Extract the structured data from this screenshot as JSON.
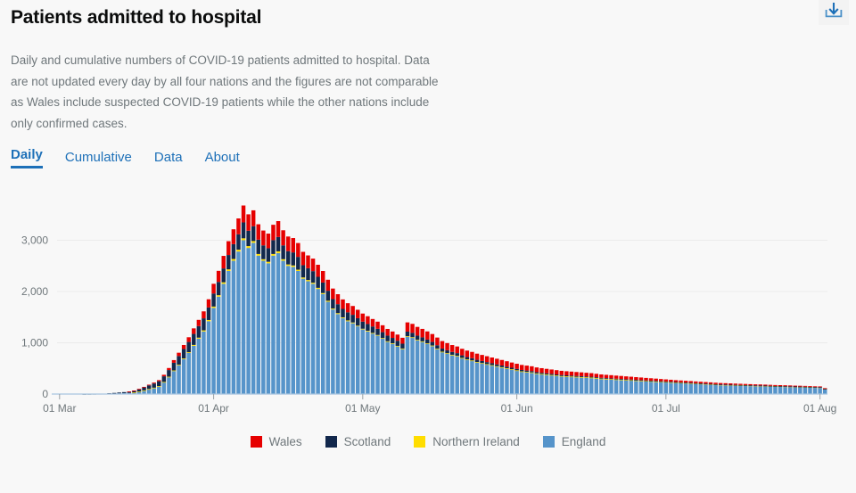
{
  "header": {
    "title": "Patients admitted to hospital",
    "description": "Daily and cumulative numbers of COVID-19 patients admitted to hospital. Data are not updated every day by all four nations and the figures are not comparable as Wales include suspected COVID-19 patients while the other nations include only confirmed cases.",
    "download_icon": "download-icon"
  },
  "tabs": [
    {
      "label": "Daily",
      "active": true
    },
    {
      "label": "Cumulative",
      "active": false
    },
    {
      "label": "Data",
      "active": false
    },
    {
      "label": "About",
      "active": false
    }
  ],
  "colors": {
    "wales": "#e60000",
    "scotland": "#12284c",
    "northern_ireland": "#ffdd00",
    "england": "#5694ca",
    "accent": "#1d70b8",
    "text_muted": "#6f777b",
    "background": "#f8f8f8",
    "gridline": "#ebebeb"
  },
  "chart_data": {
    "type": "bar",
    "stacked": true,
    "title": "Patients admitted to hospital",
    "xlabel": "",
    "ylabel": "",
    "ylim": [
      0,
      3600
    ],
    "grid": true,
    "legend_position": "bottom",
    "y_ticks": [
      "0",
      "1,000",
      "2,000",
      "3,000"
    ],
    "y_tick_values": [
      0,
      1000,
      2000,
      3000
    ],
    "x_ticks": [
      "01 Mar",
      "01 Apr",
      "01 May",
      "01 Jun",
      "01 Jul",
      "01 Aug"
    ],
    "x_tick_indices": [
      0,
      31,
      61,
      92,
      122,
      153
    ],
    "categories": [
      "01 Mar",
      "02 Mar",
      "03 Mar",
      "04 Mar",
      "05 Mar",
      "06 Mar",
      "07 Mar",
      "08 Mar",
      "09 Mar",
      "10 Mar",
      "11 Mar",
      "12 Mar",
      "13 Mar",
      "14 Mar",
      "15 Mar",
      "16 Mar",
      "17 Mar",
      "18 Mar",
      "19 Mar",
      "20 Mar",
      "21 Mar",
      "22 Mar",
      "23 Mar",
      "24 Mar",
      "25 Mar",
      "26 Mar",
      "27 Mar",
      "28 Mar",
      "29 Mar",
      "30 Mar",
      "31 Mar",
      "01 Apr",
      "02 Apr",
      "03 Apr",
      "04 Apr",
      "05 Apr",
      "06 Apr",
      "07 Apr",
      "08 Apr",
      "09 Apr",
      "10 Apr",
      "11 Apr",
      "12 Apr",
      "13 Apr",
      "14 Apr",
      "15 Apr",
      "16 Apr",
      "17 Apr",
      "18 Apr",
      "19 Apr",
      "20 Apr",
      "21 Apr",
      "22 Apr",
      "23 Apr",
      "24 Apr",
      "25 Apr",
      "26 Apr",
      "27 Apr",
      "28 Apr",
      "29 Apr",
      "30 Apr",
      "01 May",
      "02 May",
      "03 May",
      "04 May",
      "05 May",
      "06 May",
      "07 May",
      "08 May",
      "09 May",
      "10 May",
      "11 May",
      "12 May",
      "13 May",
      "14 May",
      "15 May",
      "16 May",
      "17 May",
      "18 May",
      "19 May",
      "20 May",
      "21 May",
      "22 May",
      "23 May",
      "24 May",
      "25 May",
      "26 May",
      "27 May",
      "28 May",
      "29 May",
      "30 May",
      "31 May",
      "01 Jun",
      "02 Jun",
      "03 Jun",
      "04 Jun",
      "05 Jun",
      "06 Jun",
      "07 Jun",
      "08 Jun",
      "09 Jun",
      "10 Jun",
      "11 Jun",
      "12 Jun",
      "13 Jun",
      "14 Jun",
      "15 Jun",
      "16 Jun",
      "17 Jun",
      "18 Jun",
      "19 Jun",
      "20 Jun",
      "21 Jun",
      "22 Jun",
      "23 Jun",
      "24 Jun",
      "25 Jun",
      "26 Jun",
      "27 Jun",
      "28 Jun",
      "29 Jun",
      "30 Jun",
      "01 Jul",
      "02 Jul",
      "03 Jul",
      "04 Jul",
      "05 Jul",
      "06 Jul",
      "07 Jul",
      "08 Jul",
      "09 Jul",
      "10 Jul",
      "11 Jul",
      "12 Jul",
      "13 Jul",
      "14 Jul",
      "15 Jul",
      "16 Jul",
      "17 Jul",
      "18 Jul",
      "19 Jul",
      "20 Jul",
      "21 Jul",
      "22 Jul",
      "23 Jul",
      "24 Jul",
      "25 Jul",
      "26 Jul",
      "27 Jul",
      "28 Jul",
      "29 Jul",
      "30 Jul",
      "31 Jul",
      "01 Aug",
      "02 Aug"
    ],
    "series": [
      {
        "name": "England",
        "color": "#5694ca",
        "values": [
          0,
          0,
          0,
          0,
          0,
          0,
          0,
          0,
          0,
          0,
          8,
          10,
          14,
          18,
          22,
          30,
          48,
          70,
          96,
          120,
          150,
          230,
          330,
          450,
          560,
          680,
          800,
          940,
          1080,
          1220,
          1420,
          1680,
          1900,
          2150,
          2400,
          2600,
          2780,
          3000,
          2850,
          2950,
          2700,
          2600,
          2550,
          2700,
          2750,
          2600,
          2500,
          2480,
          2400,
          2250,
          2200,
          2150,
          2050,
          1950,
          1800,
          1650,
          1560,
          1480,
          1420,
          1380,
          1320,
          1260,
          1220,
          1180,
          1140,
          1080,
          1020,
          980,
          930,
          880,
          1120,
          1100,
          1050,
          1020,
          980,
          940,
          880,
          820,
          790,
          760,
          740,
          700,
          670,
          650,
          620,
          600,
          580,
          560,
          540,
          520,
          500,
          480,
          460,
          440,
          430,
          420,
          400,
          390,
          380,
          370,
          360,
          350,
          345,
          340,
          335,
          330,
          325,
          320,
          310,
          300,
          295,
          290,
          285,
          280,
          275,
          270,
          265,
          260,
          255,
          250,
          245,
          240,
          235,
          230,
          225,
          220,
          215,
          210,
          205,
          200,
          195,
          190,
          185,
          180,
          178,
          175,
          172,
          170,
          168,
          165,
          162,
          160,
          158,
          155,
          152,
          150,
          148,
          145,
          142,
          140,
          138,
          135,
          132,
          130,
          100
        ]
      },
      {
        "name": "Northern Ireland",
        "color": "#ffdd00",
        "values": [
          0,
          0,
          0,
          0,
          0,
          0,
          0,
          0,
          0,
          0,
          0,
          0,
          0,
          0,
          0,
          1,
          1,
          2,
          3,
          4,
          5,
          6,
          8,
          10,
          12,
          14,
          16,
          18,
          20,
          22,
          24,
          26,
          28,
          30,
          32,
          34,
          36,
          38,
          36,
          34,
          32,
          30,
          30,
          32,
          34,
          30,
          28,
          28,
          26,
          24,
          24,
          22,
          22,
          20,
          20,
          18,
          18,
          16,
          16,
          16,
          14,
          14,
          14,
          12,
          12,
          12,
          10,
          10,
          10,
          8,
          8,
          8,
          8,
          8,
          8,
          6,
          6,
          6,
          6,
          6,
          6,
          5,
          5,
          5,
          5,
          4,
          4,
          4,
          4,
          4,
          4,
          3,
          3,
          3,
          3,
          3,
          3,
          2,
          2,
          2,
          2,
          2,
          2,
          2,
          2,
          2,
          2,
          2,
          2,
          2,
          2,
          2,
          2,
          2,
          2,
          2,
          2,
          2,
          2,
          2,
          2,
          2,
          2,
          2,
          2,
          2,
          2,
          2,
          2,
          2,
          2,
          2,
          2,
          2,
          2,
          2,
          2,
          2,
          2,
          2,
          2,
          2,
          2,
          2,
          2,
          2,
          2,
          2,
          2,
          2,
          2,
          2,
          2,
          2,
          1
        ]
      },
      {
        "name": "Scotland",
        "color": "#12284c",
        "values": [
          0,
          0,
          0,
          0,
          0,
          2,
          3,
          4,
          5,
          6,
          8,
          12,
          16,
          20,
          26,
          34,
          46,
          58,
          70,
          82,
          95,
          110,
          130,
          150,
          170,
          185,
          200,
          215,
          225,
          235,
          245,
          255,
          260,
          270,
          280,
          290,
          300,
          310,
          300,
          290,
          280,
          270,
          265,
          270,
          280,
          270,
          260,
          255,
          250,
          240,
          230,
          225,
          215,
          205,
          195,
          185,
          175,
          165,
          158,
          150,
          145,
          138,
          132,
          126,
          120,
          115,
          110,
          105,
          100,
          95,
          90,
          86,
          82,
          78,
          74,
          70,
          66,
          62,
          58,
          55,
          52,
          50,
          48,
          45,
          43,
          41,
          39,
          37,
          35,
          33,
          31,
          30,
          28,
          27,
          26,
          25,
          24,
          23,
          22,
          21,
          20,
          19,
          18,
          18,
          17,
          17,
          16,
          16,
          15,
          15,
          14,
          14,
          13,
          13,
          12,
          12,
          11,
          11,
          10,
          10,
          10,
          9,
          9,
          9,
          8,
          8,
          8,
          8,
          7,
          7,
          7,
          7,
          6,
          6,
          6,
          6,
          6,
          5,
          5,
          5,
          5,
          5,
          5,
          4,
          4,
          4,
          4,
          4,
          4,
          4,
          4,
          4,
          3,
          3,
          2
        ]
      },
      {
        "name": "Wales",
        "color": "#e60000",
        "values": [
          0,
          0,
          0,
          0,
          0,
          0,
          0,
          0,
          0,
          0,
          0,
          0,
          0,
          0,
          2,
          4,
          6,
          10,
          14,
          18,
          22,
          30,
          40,
          52,
          64,
          78,
          92,
          108,
          122,
          136,
          160,
          190,
          215,
          245,
          270,
          290,
          310,
          330,
          320,
          310,
          300,
          290,
          285,
          300,
          310,
          295,
          285,
          280,
          270,
          260,
          250,
          245,
          235,
          225,
          215,
          205,
          195,
          185,
          178,
          172,
          165,
          158,
          152,
          146,
          140,
          135,
          130,
          125,
          120,
          115,
          180,
          175,
          170,
          165,
          160,
          155,
          150,
          145,
          140,
          135,
          130,
          128,
          125,
          122,
          120,
          118,
          115,
          112,
          110,
          108,
          105,
          102,
          100,
          98,
          96,
          94,
          92,
          90,
          88,
          86,
          84,
          82,
          80,
          78,
          76,
          74,
          72,
          70,
          68,
          66,
          64,
          62,
          60,
          58,
          56,
          54,
          52,
          50,
          48,
          46,
          44,
          42,
          40,
          38,
          36,
          35,
          34,
          33,
          32,
          31,
          30,
          29,
          28,
          27,
          26,
          25,
          24,
          23,
          22,
          21,
          20,
          20,
          19,
          19,
          18,
          18,
          17,
          17,
          16,
          16,
          15,
          15,
          14,
          14,
          12
        ]
      }
    ]
  },
  "legend": [
    {
      "label": "Wales",
      "color": "#e60000",
      "swatch": "legend-swatch-wales"
    },
    {
      "label": "Scotland",
      "color": "#12284c",
      "swatch": "legend-swatch-scotland"
    },
    {
      "label": "Northern Ireland",
      "color": "#ffdd00",
      "swatch": "legend-swatch-northern-ireland"
    },
    {
      "label": "England",
      "color": "#5694ca",
      "swatch": "legend-swatch-england"
    }
  ]
}
